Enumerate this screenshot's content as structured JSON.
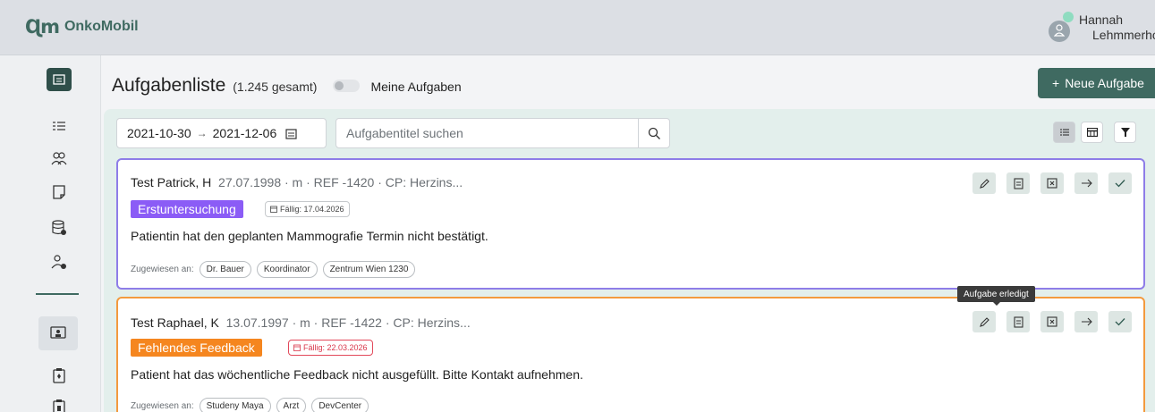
{
  "app": {
    "logo_mark": "Ɋm",
    "name": "OnkoMobil"
  },
  "user": {
    "first_name": "Hannah",
    "last_name": "Lehmmerhof"
  },
  "header": {
    "title": "Aufgabenliste",
    "count": "(1.245 gesamt)",
    "toggle_label": "Meine Aufgaben",
    "new_button": "Neue Aufgabe",
    "new_button_icon": "+"
  },
  "filters": {
    "date_from": "2021-10-30",
    "date_arrow": "→",
    "date_to": "2021-12-06",
    "search_placeholder": "Aufgabentitel suchen"
  },
  "tooltip": "Aufgabe erledigt",
  "tasks": [
    {
      "patient": "Test Patrick, H",
      "meta": "27.07.1998 · m · REF -1420 · CP: Herzins...",
      "category": "Erstuntersuchung",
      "due": "Fällig: 17.04.2026",
      "description": "Patientin hat den geplanten Mammografie Termin nicht bestätigt.",
      "assigned_label": "Zugewiesen an:",
      "assignees": [
        "Dr. Bauer",
        "Koordinator",
        "Zentrum Wien 1230"
      ],
      "accent": "#8e7de8"
    },
    {
      "patient": "Test Raphael, K",
      "meta": "13.07.1997 · m · REF -1422 · CP: Herzins...",
      "category": "Fehlendes Feedback",
      "due": "Fällig: 22.03.2026",
      "description": "Patient hat das wöchentliche Feedback nicht ausgefüllt. Bitte Kontakt aufnehmen.",
      "assigned_label": "Zugewiesen an:",
      "assignees": [
        "Studeny Maya",
        "Arzt",
        "DevCenter"
      ],
      "accent": "#f39a3e"
    }
  ],
  "colors": {
    "brand": "#3f6a61",
    "purple_badge": "#8b5cf6",
    "orange_badge": "#f5861f"
  }
}
